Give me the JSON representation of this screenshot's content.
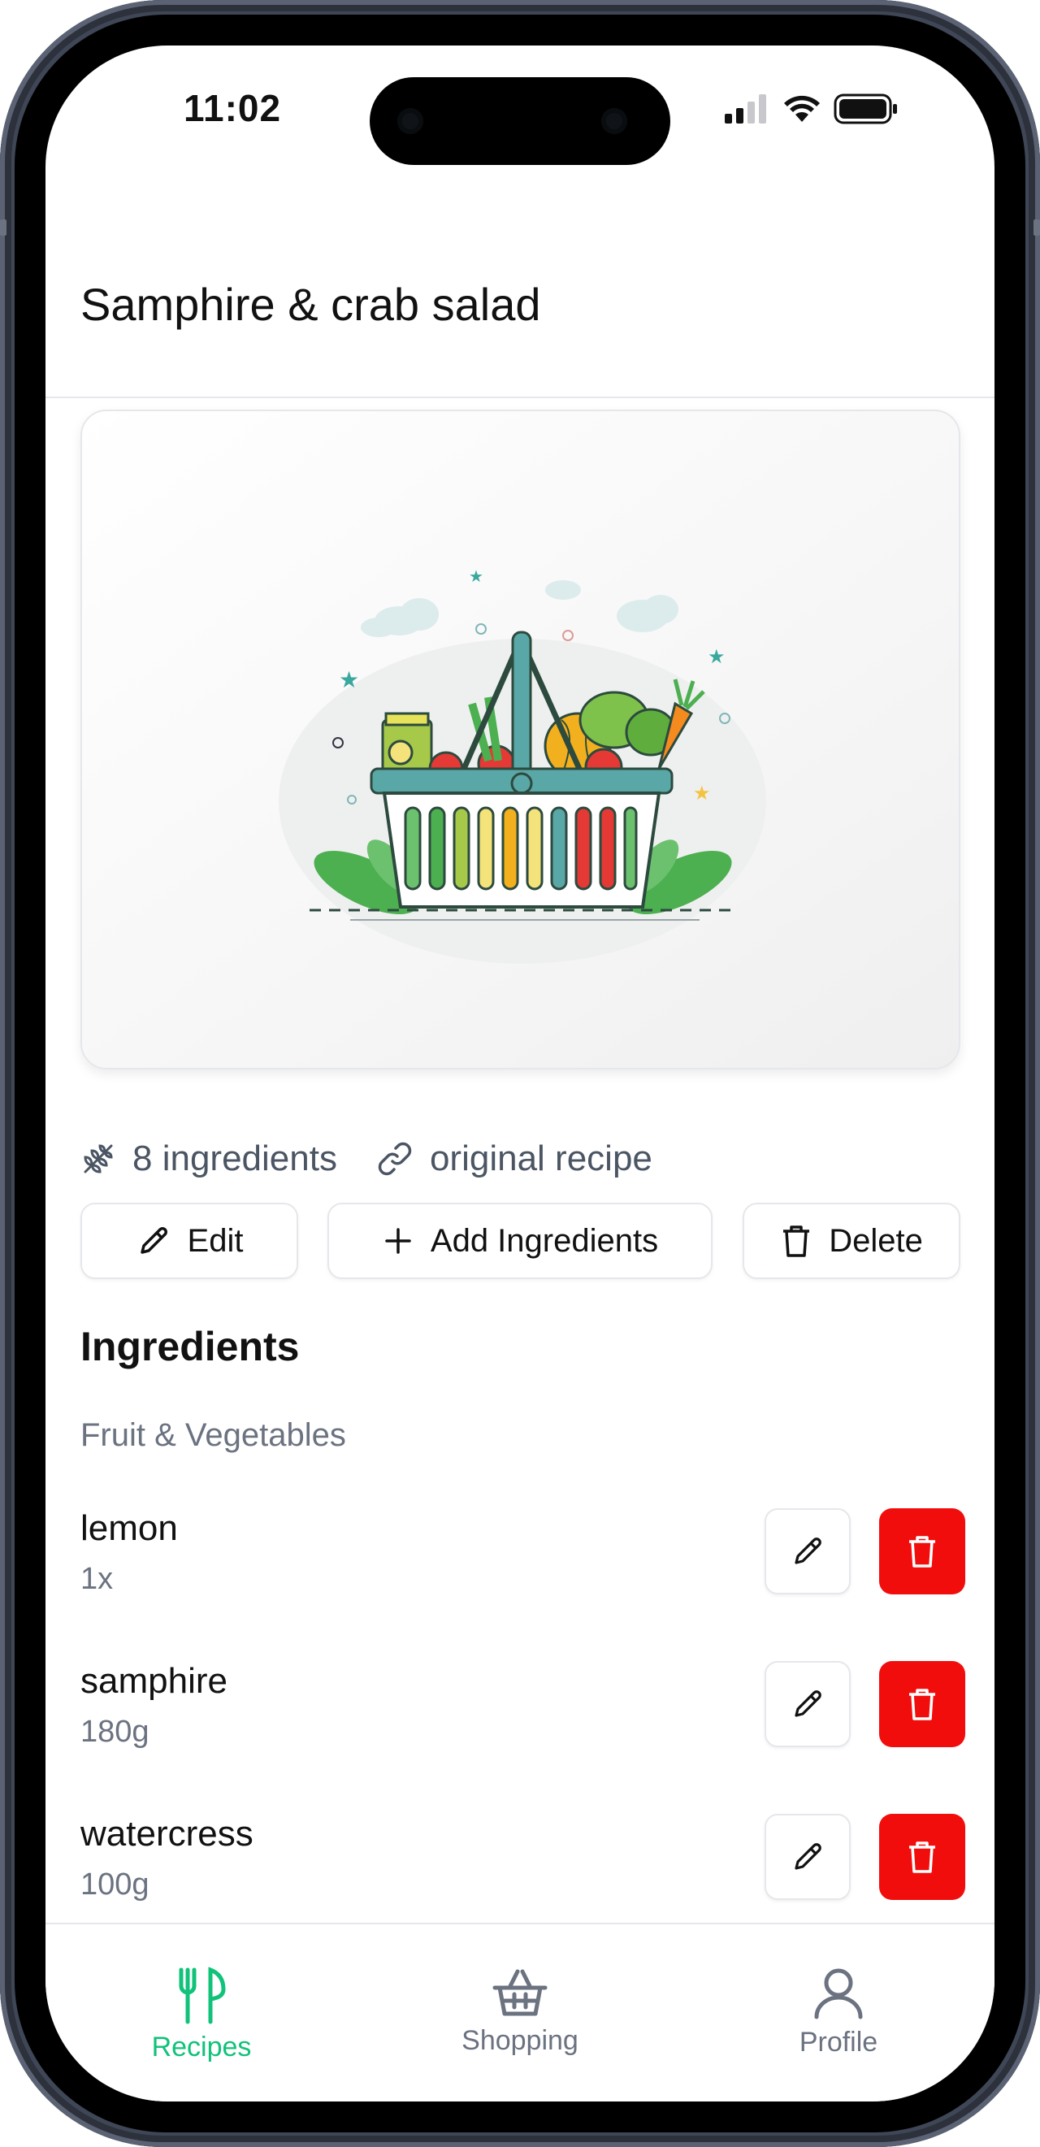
{
  "status_bar": {
    "time": "11:02",
    "icons": [
      "cellular-signal-icon",
      "wifi-icon",
      "battery-icon"
    ]
  },
  "header": {
    "title": "Samphire & crab salad"
  },
  "hero": {
    "image_icon": "grocery-basket-illustration"
  },
  "meta": {
    "ingredients_count": "8 ingredients",
    "original_recipe": "original recipe"
  },
  "actions": {
    "edit": "Edit",
    "add_ingredients": "Add Ingredients",
    "delete": "Delete"
  },
  "ingredients": {
    "title": "Ingredients",
    "category": "Fruit & Vegetables",
    "items": [
      {
        "name": "lemon",
        "quantity": "1x"
      },
      {
        "name": "samphire",
        "quantity": "180g"
      },
      {
        "name": "watercress",
        "quantity": "100g"
      }
    ]
  },
  "tabbar": {
    "tabs": [
      {
        "label": "Recipes",
        "icon": "fork-knife-icon",
        "active": true
      },
      {
        "label": "Shopping",
        "icon": "basket-icon",
        "active": false
      },
      {
        "label": "Profile",
        "icon": "user-icon",
        "active": false
      }
    ]
  },
  "colors": {
    "accent": "#10c27a",
    "danger": "#f20d0d",
    "muted_text": "#6b7280",
    "border": "#e5e7eb"
  }
}
